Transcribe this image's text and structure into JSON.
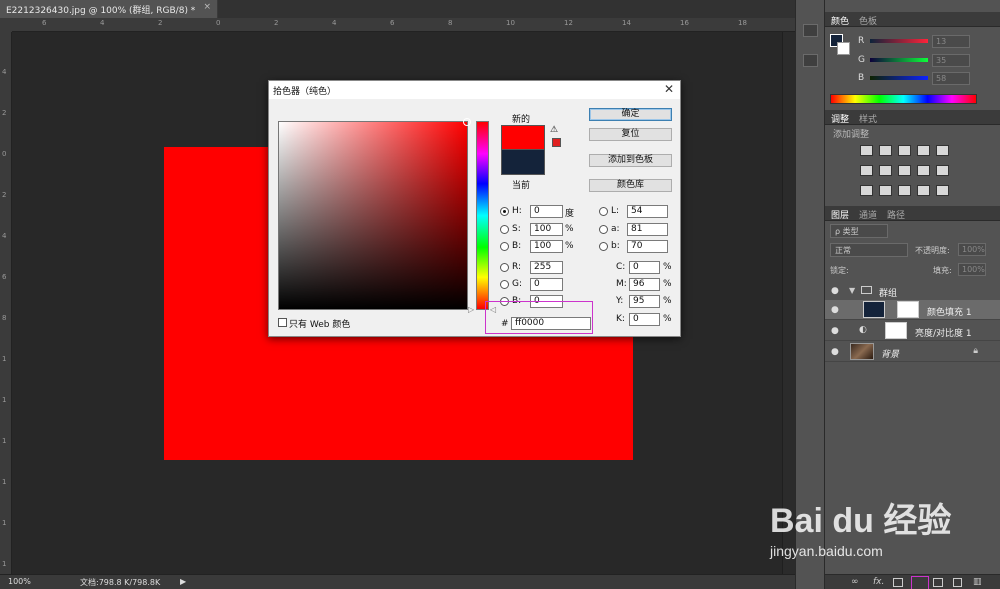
{
  "document": {
    "tab_title": "E2212326430.jpg @ 100% (群组, RGB/8) *",
    "close_glyph": "×"
  },
  "ruler": {
    "top": [
      "6",
      "4",
      "2",
      "0",
      "2",
      "4",
      "6",
      "8",
      "10",
      "12",
      "14",
      "16",
      "18"
    ],
    "left": [
      "4",
      "2",
      "0",
      "2",
      "4",
      "6",
      "8",
      "1",
      "1",
      "1",
      "1",
      "1",
      "1"
    ]
  },
  "status": {
    "zoom": "100%",
    "doc_size": "文档:798.8 K/798.8K"
  },
  "color_panel": {
    "tabs": [
      "颜色",
      "色板"
    ],
    "channels": [
      {
        "label": "R",
        "value": "13"
      },
      {
        "label": "G",
        "value": "35"
      },
      {
        "label": "B",
        "value": "58"
      }
    ]
  },
  "adjust_panel": {
    "tabs": [
      "调整",
      "样式"
    ],
    "hint": "添加调整"
  },
  "layers_panel": {
    "tabs": [
      "图层",
      "通道",
      "路径"
    ],
    "filter_label": "ρ 类型",
    "blend_mode": "正常",
    "opacity_label": "不透明度:",
    "opacity_value": "100%",
    "lock_label": "锁定:",
    "fill_label": "填充:",
    "fill_value": "100%",
    "layers": [
      {
        "name": "群组"
      },
      {
        "name": "颜色填充 1"
      },
      {
        "name": "亮度/对比度 1"
      },
      {
        "name": "背景"
      }
    ]
  },
  "dialog": {
    "title": "拾色器（纯色）",
    "new_label": "新的",
    "current_label": "当前",
    "new_color": "#ff0000",
    "current_color": "#14233a",
    "buttons": {
      "ok": "确定",
      "reset": "复位",
      "add_swatch": "添加到色板",
      "libraries": "颜色库"
    },
    "web_only_label": "只有 Web 颜色",
    "fields": {
      "H": {
        "label": "H:",
        "value": "0",
        "unit": "度"
      },
      "S": {
        "label": "S:",
        "value": "100",
        "unit": "%"
      },
      "Bv": {
        "label": "B:",
        "value": "100",
        "unit": "%"
      },
      "R": {
        "label": "R:",
        "value": "255"
      },
      "G": {
        "label": "G:",
        "value": "0"
      },
      "B": {
        "label": "B:",
        "value": "0"
      },
      "L": {
        "label": "L:",
        "value": "54"
      },
      "a": {
        "label": "a:",
        "value": "81"
      },
      "b": {
        "label": "b:",
        "value": "70"
      },
      "C": {
        "label": "C:",
        "value": "0",
        "unit": "%"
      },
      "M": {
        "label": "M:",
        "value": "96",
        "unit": "%"
      },
      "Y": {
        "label": "Y:",
        "value": "95",
        "unit": "%"
      },
      "K": {
        "label": "K:",
        "value": "0",
        "unit": "%"
      }
    },
    "hex_label": "#",
    "hex_value": "ff0000"
  },
  "watermark": {
    "text": "Bai du 经验",
    "url": "jingyan.baidu.com"
  }
}
